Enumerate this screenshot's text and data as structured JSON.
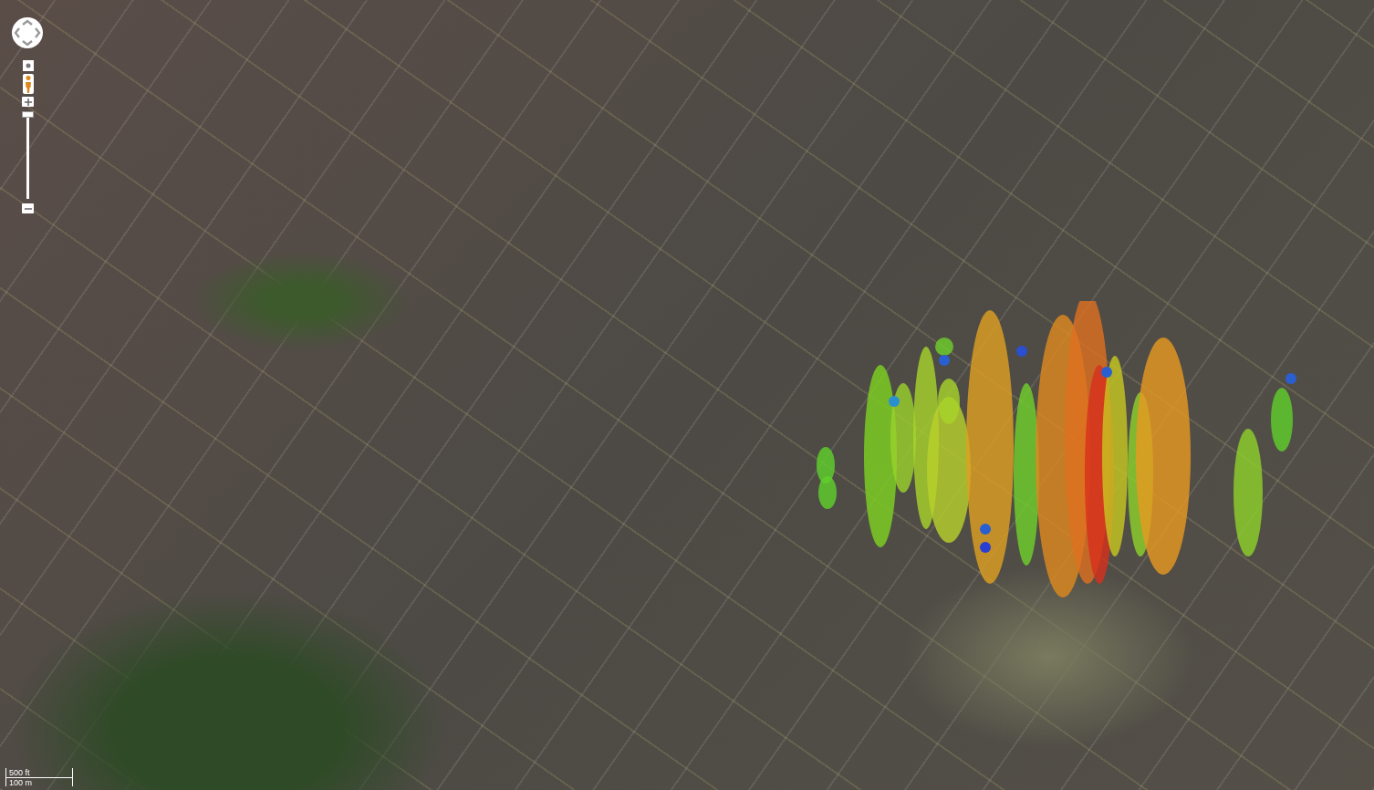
{
  "map": {
    "kind": "satellite"
  },
  "zoom_slider": {
    "level": 1
  },
  "scale_bar": {
    "imperial": "500 ft",
    "metric": "100 m"
  }
}
